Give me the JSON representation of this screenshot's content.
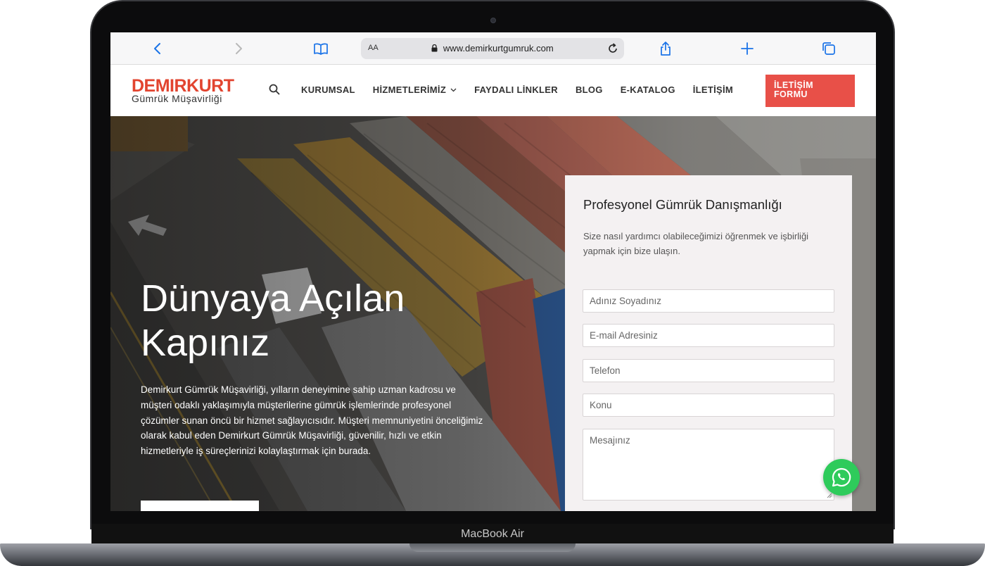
{
  "device": {
    "model_label": "MacBook Air"
  },
  "browser": {
    "reader_label": "AA",
    "url": "www.demirkurtgumruk.com",
    "icons": [
      "back-icon",
      "forward-icon",
      "bookmarks-icon",
      "lock-icon",
      "reload-icon",
      "share-icon",
      "new-tab-icon",
      "tabs-icon"
    ]
  },
  "header": {
    "logo_main": "DEMIRKURT",
    "logo_sub": "Gümrük Müşavirliği",
    "nav": [
      "KURUMSAL",
      "HİZMETLERİMİZ",
      "FAYDALI LİNKLER",
      "BLOG",
      "E-KATALOG",
      "İLETİŞİM"
    ],
    "cta_line1": "İLETİŞİM",
    "cta_line2": "FORMU",
    "cta_color": "#e85048",
    "brand_color": "#e2442f"
  },
  "hero": {
    "title_line1": "Dünyaya Açılan",
    "title_line2": "Kapınız",
    "text": "Demirkurt Gümrük Müşavirliği, yılların deneyimine sahip uzman kadrosu ve müşteri odaklı yaklaşımıyla müşterilerine gümrük işlemlerinde profesyonel çözümler sunan öncü bir hizmet sağlayıcısıdır. Müşteri memnuniyetini önceliğimiz olarak kabul eden Demirkurt Gümrük Müşavirliği, güvenilir, hızlı ve etkin hizmetleriyle iş süreçlerinizi kolaylaştırmak için burada."
  },
  "form": {
    "title": "Profesyonel Gümrük Danışmanlığı",
    "description": "Size nasıl yardımcı olabileceğimizi öğrenmek ve işbirliği yapmak için bize ulaşın.",
    "placeholders": {
      "name": "Adınız Soyadınız",
      "email": "E-mail Adresiniz",
      "phone": "Telefon",
      "subject": "Konu",
      "message": "Mesajınız"
    }
  },
  "whatsapp": {
    "color": "#2ecb5b",
    "icon": "whatsapp-icon"
  }
}
